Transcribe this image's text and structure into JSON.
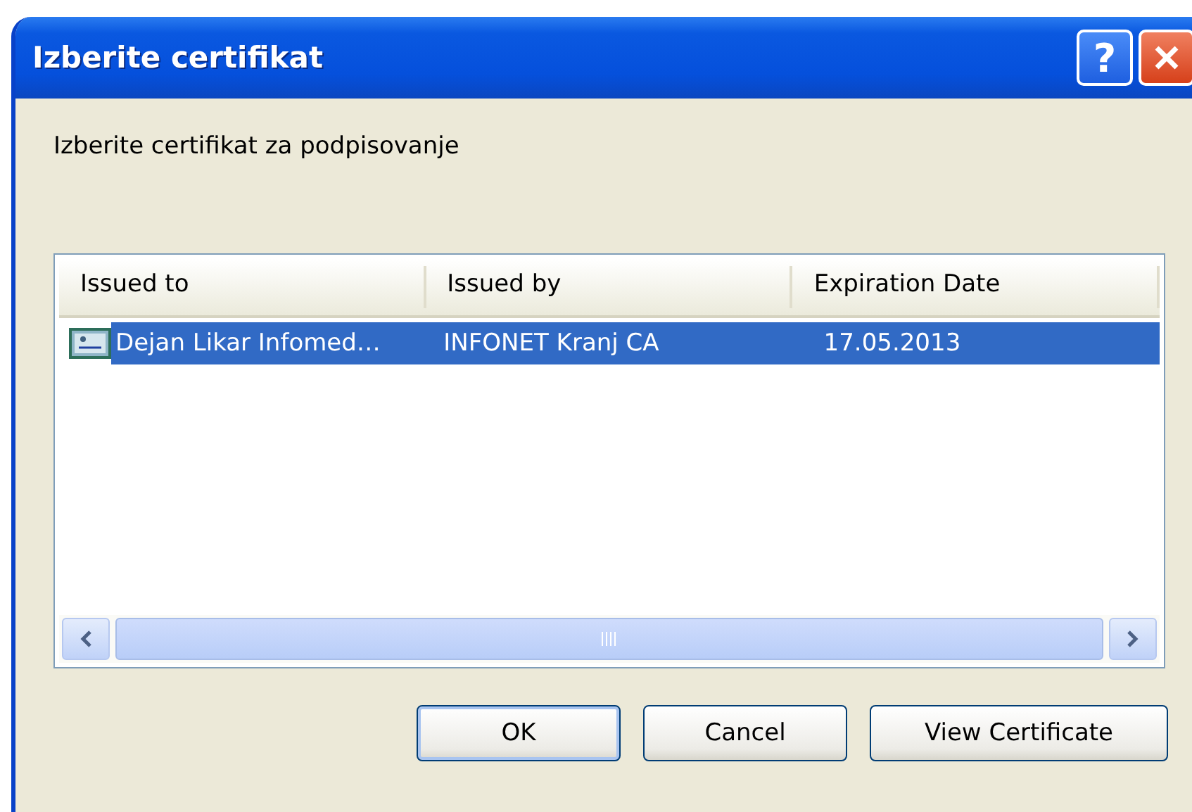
{
  "window": {
    "title": "Izberite certifikat",
    "title_buttons": [
      {
        "kind": "help",
        "label": "?"
      },
      {
        "kind": "close"
      }
    ]
  },
  "instruction": "Izberite certifikat za podpisovanje",
  "table": {
    "columns": [
      "Issued to",
      "Issued by",
      "Expiration Date"
    ],
    "rows": [
      {
        "selected": true,
        "cells": [
          "Dejan Likar Infomed…",
          "INFONET Kranj CA",
          "17.05.2013"
        ]
      }
    ]
  },
  "buttons": [
    {
      "label": "OK",
      "default": true
    },
    {
      "label": "Cancel",
      "default": false
    },
    {
      "label": "View Certificate",
      "default": false
    }
  ]
}
